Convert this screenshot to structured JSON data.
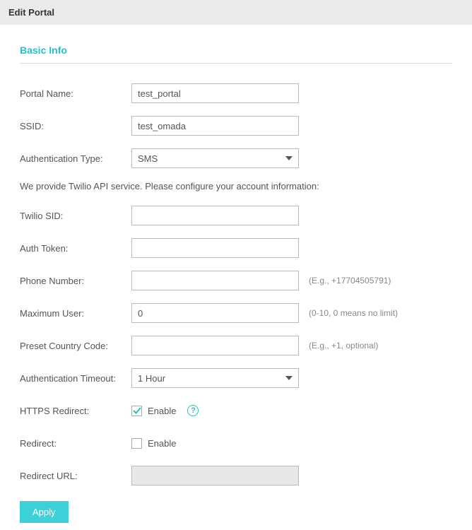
{
  "header": {
    "title": "Edit Portal"
  },
  "section": {
    "title": "Basic Info"
  },
  "form": {
    "portal_name": {
      "label": "Portal Name:",
      "value": "test_portal"
    },
    "ssid": {
      "label": "SSID:",
      "value": "test_omada"
    },
    "auth_type": {
      "label": "Authentication Type:",
      "value": "SMS"
    },
    "twilio_info": "We provide Twilio API service. Please configure your account information:",
    "twilio_sid": {
      "label": "Twilio SID:",
      "value": ""
    },
    "auth_token": {
      "label": "Auth Token:",
      "value": ""
    },
    "phone_number": {
      "label": "Phone Number:",
      "value": "",
      "hint": "(E.g., +17704505791)"
    },
    "max_user": {
      "label": "Maximum User:",
      "value": "0",
      "hint": "(0-10, 0 means no limit)"
    },
    "preset_country": {
      "label": "Preset Country Code:",
      "value": "",
      "hint": "(E.g., +1, optional)"
    },
    "auth_timeout": {
      "label": "Authentication Timeout:",
      "value": "1 Hour"
    },
    "https_redirect": {
      "label": "HTTPS Redirect:",
      "enable_label": "Enable"
    },
    "redirect": {
      "label": "Redirect:",
      "enable_label": "Enable"
    },
    "redirect_url": {
      "label": "Redirect URL:",
      "value": ""
    }
  },
  "buttons": {
    "apply": "Apply"
  }
}
